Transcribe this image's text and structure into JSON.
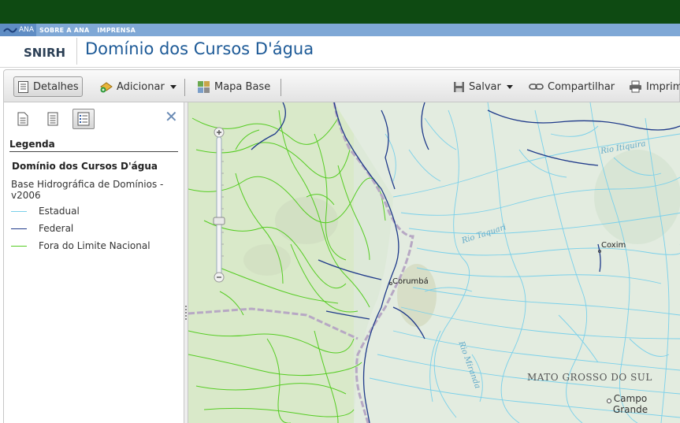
{
  "top_bar": {
    "logo_text": "ANA",
    "links": [
      "SOBRE A ANA",
      "IMPRENSA"
    ]
  },
  "header": {
    "brand": "SNIRH",
    "title": "Domínio dos Cursos D'água"
  },
  "toolbar": {
    "details_label": "Detalhes",
    "add_label": "Adicionar",
    "basemap_label": "Mapa Base",
    "save_label": "Salvar",
    "share_label": "Compartilhar",
    "print_label": "Imprimir"
  },
  "legend": {
    "heading": "Legenda",
    "layer_title": "Domínio dos Cursos D'água",
    "sublayer_title": "Base Hidrográfica de Domínios - v2006",
    "items": [
      {
        "label": "Estadual",
        "color": "#7ad0ea"
      },
      {
        "label": "Federal",
        "color": "#1f3a8a"
      },
      {
        "label": "Fora do Limite Nacional",
        "color": "#55cc22"
      }
    ]
  },
  "map": {
    "labels": {
      "rio_itiquira": "Rio Itiquira",
      "rio_taquari": "Rio Taquari",
      "coxim": "Coxim",
      "corumba": "Corumbá",
      "rio_miranda": "Rio Miranda",
      "state": "MATO GROSSO DO SUL",
      "campo_grande": "Campo Grande"
    }
  },
  "colors": {
    "gov_bar": "#0e4a12",
    "ana_bar": "#7fa8d6",
    "title": "#1d5a97",
    "state_rivers": "#7ad0ea",
    "federal_rivers": "#1f3a8a",
    "foreign_rivers": "#55cc22"
  }
}
